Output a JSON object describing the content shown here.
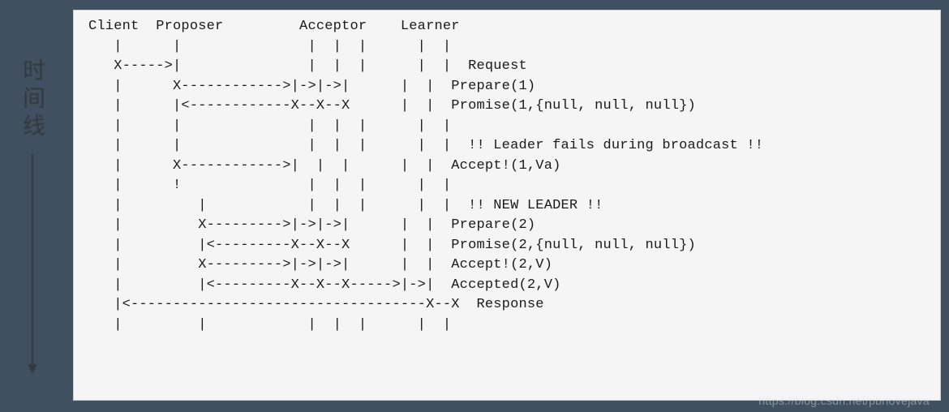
{
  "timeline": {
    "label": "时间线"
  },
  "diagram": {
    "header": "Client  Proposer         Acceptor    Learner",
    "rows": [
      "   |      |               |  |  |      |  |",
      "   X----->|               |  |  |      |  |  Request",
      "   |      X------------>|->|->|      |  |  Prepare(1)",
      "   |      |<------------X--X--X      |  |  Promise(1,{null, null, null})",
      "   |      |               |  |  |      |  |",
      "   |      |               |  |  |      |  |  !! Leader fails during broadcast !!",
      "   |      X------------>|  |  |      |  |  Accept!(1,Va)",
      "   |      !               |  |  |      |  |",
      "   |         |            |  |  |      |  |  !! NEW LEADER !!",
      "   |         X--------->|->|->|      |  |  Prepare(2)",
      "   |         |<---------X--X--X      |  |  Promise(2,{null, null, null})",
      "   |         X--------->|->|->|      |  |  Accept!(2,V)",
      "   |         |<---------X--X--X----->|->|  Accepted(2,V)",
      "   |<-----------------------------------X--X  Response",
      "   |         |            |  |  |      |  |"
    ]
  },
  "watermark": "https://blog.csdn.net/pbrlovejava"
}
